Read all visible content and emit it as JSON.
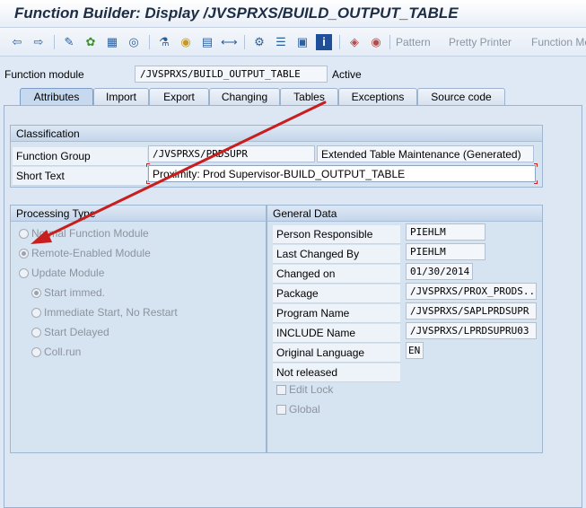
{
  "window": {
    "title": "Function Builder: Display /JVSPRXS/BUILD_OUTPUT_TABLE"
  },
  "toolbar": {
    "icons": [
      "back-arrow-icon",
      "forward-arrow-icon",
      "display-change-icon",
      "activate-icon",
      "other-object-icon",
      "where-used-icon",
      "hierarchy-icon",
      "pin-icon",
      "object-list-icon",
      "navigate-icon",
      "tree-icon",
      "stack-icon",
      "display-object-icon",
      "info-icon",
      "test-icon",
      "debug-icon"
    ],
    "pattern_label": "Pattern",
    "pretty_printer_label": "Pretty Printer",
    "function_module_label": "Function Mo"
  },
  "function_module": {
    "label": "Function module",
    "value": "/JVSPRXS/BUILD_OUTPUT_TABLE",
    "status": "Active"
  },
  "tabs": [
    {
      "label": "Attributes",
      "active": true
    },
    {
      "label": "Import",
      "active": false
    },
    {
      "label": "Export",
      "active": false
    },
    {
      "label": "Changing",
      "active": false
    },
    {
      "label": "Tables",
      "active": false
    },
    {
      "label": "Exceptions",
      "active": false
    },
    {
      "label": "Source code",
      "active": false
    }
  ],
  "classification": {
    "title": "Classification",
    "function_group_label": "Function Group",
    "function_group_value": "/JVSPRXS/PRDSUPR",
    "function_group_desc": "Extended Table Maintenance (Generated)",
    "short_text_label": "Short Text",
    "short_text_value": "Proximity: Prod Supervisor-BUILD_OUTPUT_TABLE"
  },
  "processing_type": {
    "title": "Processing Type",
    "options": [
      {
        "label": "Normal Function Module",
        "selected": false
      },
      {
        "label": "Remote-Enabled Module",
        "selected": true
      },
      {
        "label": "Update Module",
        "selected": false
      }
    ],
    "sub_options": [
      {
        "label": "Start immed.",
        "selected": true
      },
      {
        "label": "Immediate Start, No Restart",
        "selected": false
      },
      {
        "label": "Start Delayed",
        "selected": false
      },
      {
        "label": "Coll.run",
        "selected": false
      }
    ]
  },
  "general_data": {
    "title": "General Data",
    "rows": [
      {
        "label": "Person Responsible",
        "value": "PIEHLM"
      },
      {
        "label": "Last Changed By",
        "value": "PIEHLM"
      },
      {
        "label": "Changed on",
        "value": "01/30/2014"
      },
      {
        "label": "Package",
        "value": "/JVSPRXS/PROX_PRODS..."
      },
      {
        "label": "Program Name",
        "value": "/JVSPRXS/SAPLPRDSUPR"
      },
      {
        "label": "INCLUDE Name",
        "value": "/JVSPRXS/LPRDSUPRU03"
      },
      {
        "label": "Original Language",
        "value": "EN"
      }
    ],
    "release_status": "Not released",
    "edit_lock_label": "Edit Lock",
    "global_label": "Global"
  },
  "colors": {
    "annotation_arrow": "#c81e1e",
    "accent": "#2c5f9e",
    "background": "#dfe9f5"
  }
}
